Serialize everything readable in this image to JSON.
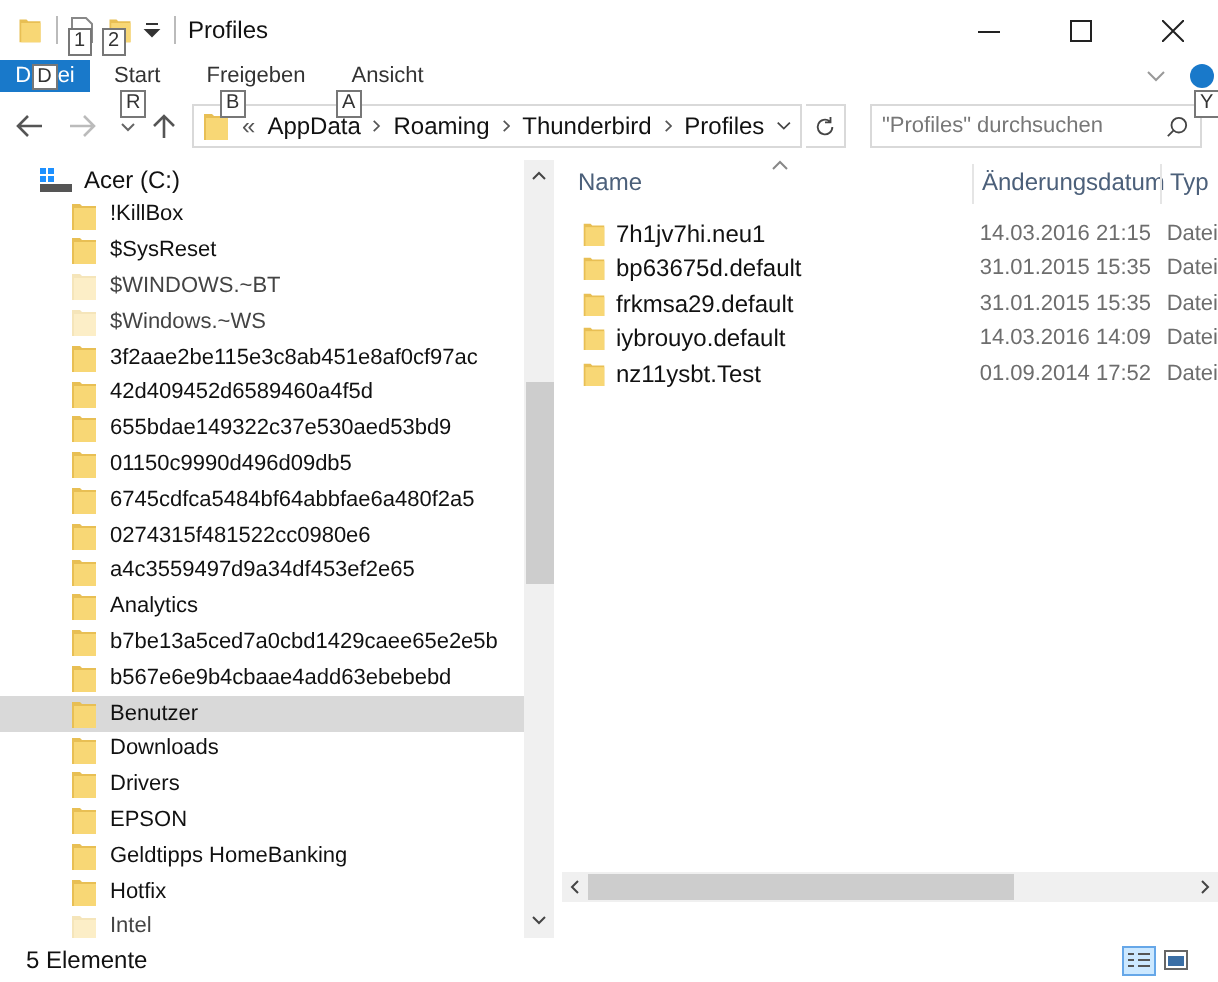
{
  "window": {
    "title": "Profiles"
  },
  "quick_access_keytips": [
    "1",
    "2"
  ],
  "ribbon": {
    "file_tab": {
      "label_start": "D",
      "keytip": "D",
      "label_end": "ei"
    },
    "tabs": [
      {
        "label": "Start",
        "keytip": "R"
      },
      {
        "label": "Freigeben",
        "keytip": "B"
      },
      {
        "label": "Ansicht",
        "keytip": "A"
      }
    ],
    "help_keytip": "Y"
  },
  "address_bar": {
    "overflow": "«",
    "path": [
      "AppData",
      "Roaming",
      "Thunderbird",
      "Profiles"
    ],
    "search": {
      "placeholder": "\"Profiles\" durchsuchen"
    }
  },
  "navigation_pane": {
    "drive": {
      "label": "Acer (C:)"
    },
    "items": [
      {
        "label": "!KillBox",
        "hidden": false,
        "selected": false
      },
      {
        "label": "$SysReset",
        "hidden": false,
        "selected": false
      },
      {
        "label": "$WINDOWS.~BT",
        "hidden": true,
        "selected": false
      },
      {
        "label": "$Windows.~WS",
        "hidden": true,
        "selected": false
      },
      {
        "label": "3f2aae2be115e3c8ab451e8af0cf97ac",
        "hidden": false,
        "selected": false
      },
      {
        "label": "42d409452d6589460a4f5d",
        "hidden": false,
        "selected": false
      },
      {
        "label": "655bdae149322c37e530aed53bd9",
        "hidden": false,
        "selected": false
      },
      {
        "label": "01150c9990d496d09db5",
        "hidden": false,
        "selected": false
      },
      {
        "label": "6745cdfca5484bf64abbfae6a480f2a5",
        "hidden": false,
        "selected": false
      },
      {
        "label": "0274315f481522cc0980e6",
        "hidden": false,
        "selected": false
      },
      {
        "label": "a4c3559497d9a34df453ef2e65",
        "hidden": false,
        "selected": false
      },
      {
        "label": "Analytics",
        "hidden": false,
        "selected": false
      },
      {
        "label": "b7be13a5ced7a0cbd1429caee65e2e5b",
        "hidden": false,
        "selected": false
      },
      {
        "label": "b567e6e9b4cbaae4add63ebebebd",
        "hidden": false,
        "selected": false
      },
      {
        "label": "Benutzer",
        "hidden": false,
        "selected": true
      },
      {
        "label": "Downloads",
        "hidden": false,
        "selected": false
      },
      {
        "label": "Drivers",
        "hidden": false,
        "selected": false
      },
      {
        "label": "EPSON",
        "hidden": false,
        "selected": false
      },
      {
        "label": "Geldtipps HomeBanking",
        "hidden": false,
        "selected": false
      },
      {
        "label": "Hotfix",
        "hidden": false,
        "selected": false
      },
      {
        "label": "Intel",
        "hidden": true,
        "selected": false
      }
    ]
  },
  "file_list": {
    "columns": [
      "Name",
      "Änderungsdatum",
      "Typ"
    ],
    "rows": [
      {
        "name": "7h1jv7hi.neu1",
        "modified": "14.03.2016 21:15",
        "type": "Datei"
      },
      {
        "name": "bp63675d.default",
        "modified": "31.01.2015 15:35",
        "type": "Datei"
      },
      {
        "name": "frkmsa29.default",
        "modified": "31.01.2015 15:35",
        "type": "Datei"
      },
      {
        "name": "iybrouyo.default",
        "modified": "14.03.2016 14:09",
        "type": "Datei"
      },
      {
        "name": "nz11ysbt.Test",
        "modified": "01.09.2014 17:52",
        "type": "Datei"
      }
    ]
  },
  "status_bar": {
    "item_count": "5 Elemente"
  }
}
